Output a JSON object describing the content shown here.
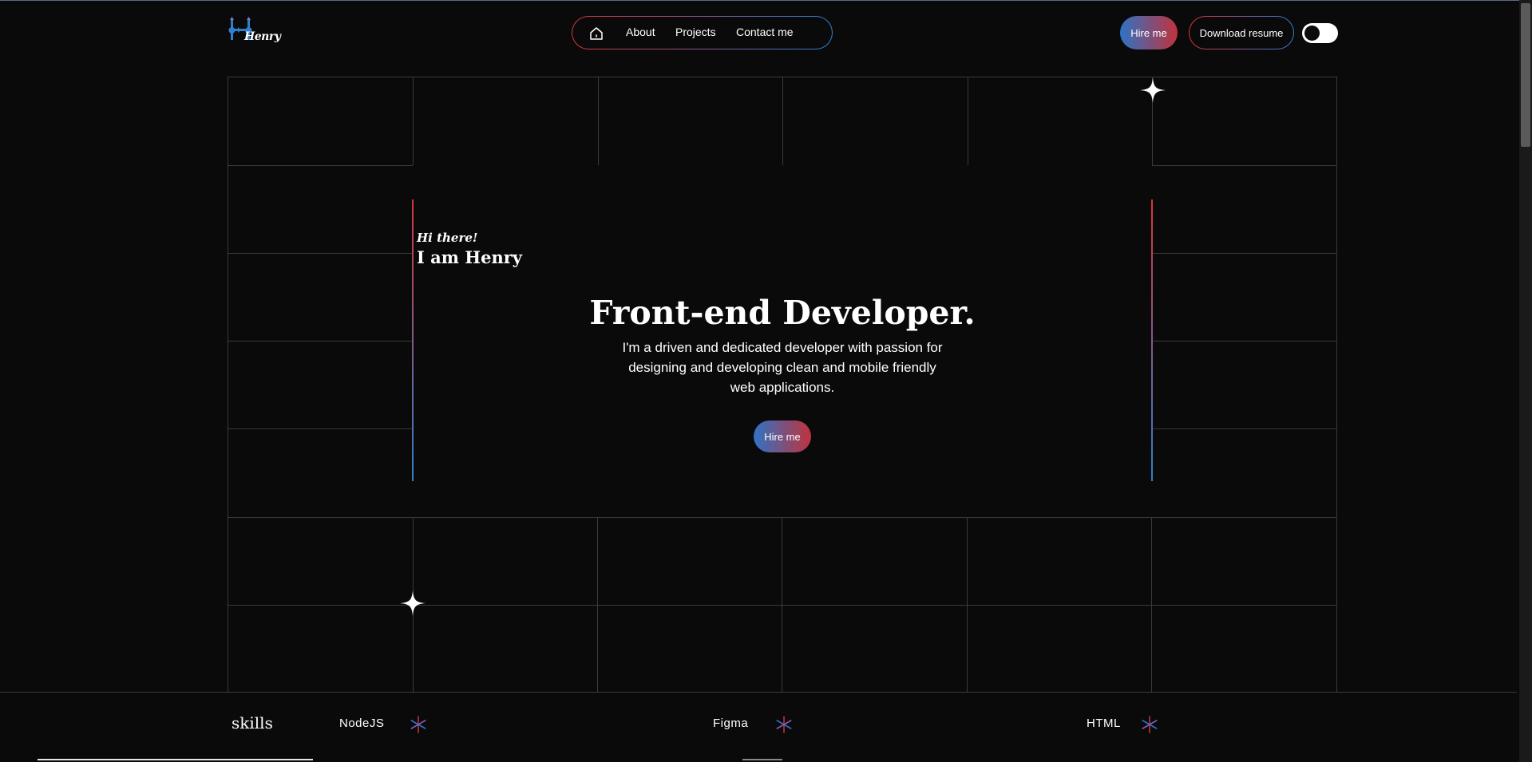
{
  "header": {
    "logo_text": "Henry",
    "nav": {
      "home_icon": "home-icon",
      "items": [
        "About",
        "Projects",
        "Contact me"
      ]
    },
    "hire_label": "Hire me",
    "download_label": "Download resume",
    "theme_toggle": "dark-mode"
  },
  "hero": {
    "greeting": "Hi there!",
    "intro": "I am Henry",
    "headline": "Front-end Developer.",
    "description": "I'm a driven and dedicated developer with passion for designing and developing clean and mobile friendly web applications.",
    "cta_label": "Hire me"
  },
  "skills": {
    "title": "skills",
    "items": [
      "NodeJS",
      "Figma",
      "HTML"
    ]
  },
  "colors": {
    "background": "#0a0a0a",
    "accent_red": "#d8343c",
    "accent_blue": "#2f7fd0",
    "grid_line": "#3a3a3a"
  }
}
